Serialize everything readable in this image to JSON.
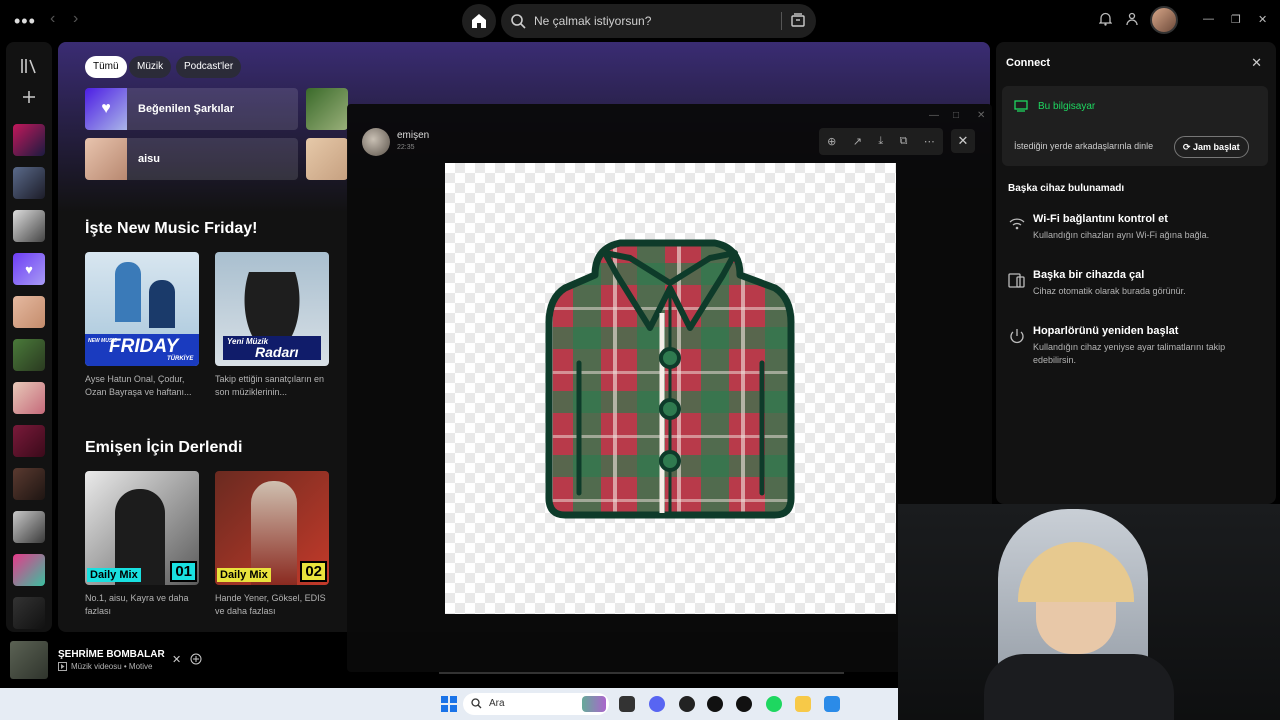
{
  "topbar": {
    "search_placeholder": "Ne çalmak istiyorsun?"
  },
  "filters": [
    "Tümü",
    "Müzik",
    "Podcast'ler"
  ],
  "quick_access": [
    {
      "label": "Beğenilen Şarkılar"
    },
    {
      "label": "aisu"
    }
  ],
  "section1": {
    "title": "İşte New Music Friday!",
    "cards": [
      {
        "desc": "Ayse Hatun Onal, Çodur, Ozan Bayraşa ve haftanı...",
        "art_text": "FRIDAY",
        "art_sub": "TÜRKİYE",
        "art_top": "NEW MUSIC"
      },
      {
        "desc": "Takip ettiğin sanatçıların en son müziklerinin...",
        "art_text": "Radarı",
        "art_top": "Yeni Müzik"
      }
    ]
  },
  "section2": {
    "title": "Emişen İçin Derlendi",
    "cards": [
      {
        "desc": "No.1, aisu, Kayra ve daha fazlası",
        "badge": "Daily Mix",
        "num": "01"
      },
      {
        "desc": "Hande Yener, Göksel, EDIS ve daha fazlası",
        "badge": "Daily Mix",
        "num": "02"
      }
    ]
  },
  "now_playing": {
    "title": "ŞEHRİME BOMBALAR",
    "subtitle": "Müzik videosu • Motive"
  },
  "connect": {
    "title": "Connect",
    "current_device": "Bu bilgisayar",
    "jam_text": "İstediğin yerde arkadaşlarınla dinle",
    "jam_button": "Jam başlat",
    "no_devices": "Başka cihaz bulunamadı",
    "options": [
      {
        "title": "Wi-Fi bağlantını kontrol et",
        "desc": "Kullandığın cihazları aynı Wi-Fi ağına bağla.",
        "icon": "wifi-icon"
      },
      {
        "title": "Başka bir cihazda çal",
        "desc": "Cihaz otomatik olarak burada görünür.",
        "icon": "devices-icon"
      },
      {
        "title": "Hoparlörünü yeniden başlat",
        "desc": "Kullandığın cihaz yeniyse ayar talimatlarını takip edebilirsin.",
        "icon": "power-icon"
      }
    ]
  },
  "viewer": {
    "user": "emişen",
    "time": "22:35"
  },
  "taskbar": {
    "search": "Ara"
  },
  "colors": {
    "accent": "#1ed760",
    "shirt_red": "#b83a4a",
    "shirt_green": "#2f7a4f",
    "shirt_outline": "#0e3b2a"
  }
}
